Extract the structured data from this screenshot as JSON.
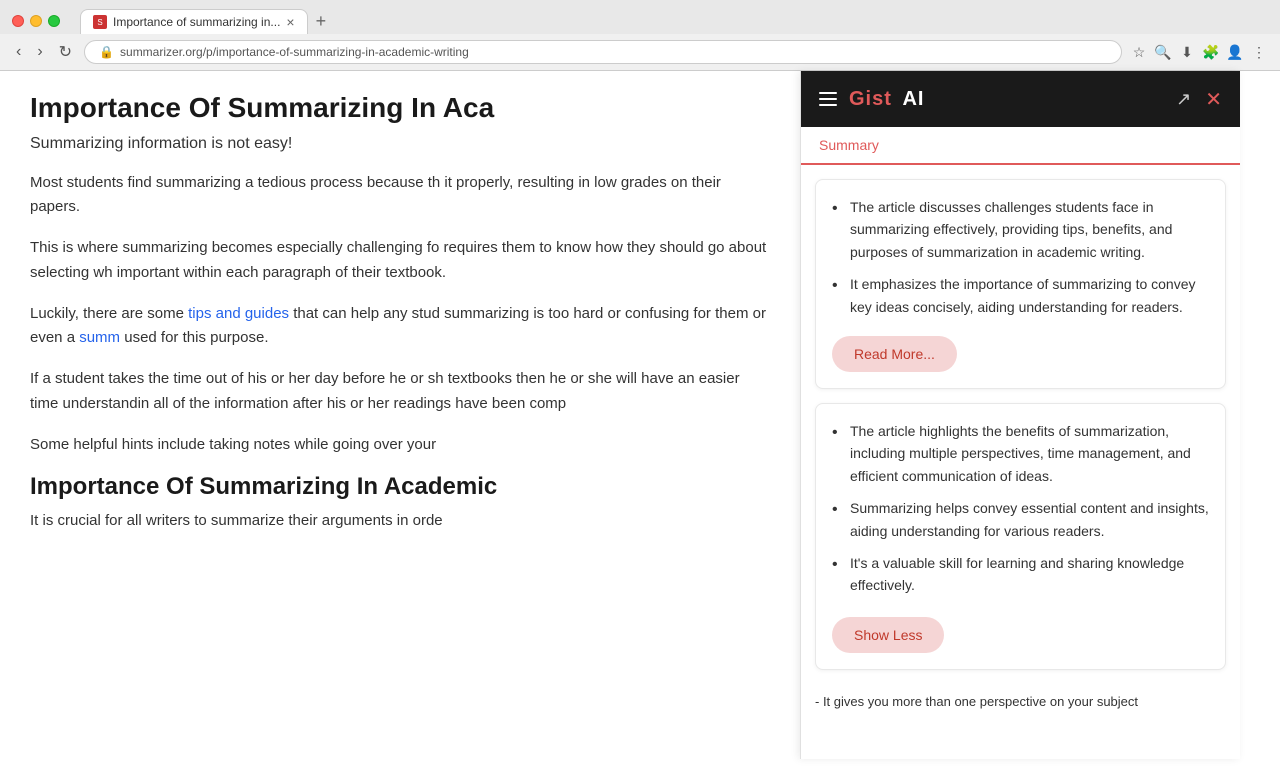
{
  "browser": {
    "tab_title": "Importance of summarizing in...",
    "tab_favicon": "S",
    "url": "summarizer.org/p/importance-of-summarizing-in-academic-writing",
    "new_tab_icon": "+",
    "nav_back": "‹",
    "nav_forward": "›",
    "nav_reload": "↺",
    "actions": [
      "🔍",
      "★",
      "⬇",
      "⋮",
      "□",
      "👤"
    ]
  },
  "article": {
    "title": "Importance Of Summarizing In Aca",
    "subtitle": "Summarizing information is not easy!",
    "paragraph1": "Most students find summarizing a tedious process because th it properly, resulting in low grades on their papers.",
    "paragraph2": "This is where summarizing becomes especially challenging fo requires them to know how they should go about selecting wh important within each paragraph of their textbook.",
    "paragraph3_prefix": "Luckily, there are some ",
    "paragraph3_link1": "tips and guides",
    "paragraph3_middle": " that can help any stud summarizing is too hard or confusing for them or even a ",
    "paragraph3_link2": "summ",
    "paragraph3_suffix": " used for this purpose.",
    "paragraph4": "If a student takes the time out of his or her day before he or sh textbooks then he or she will have an easier time understandin all of the information after his or her readings have been comp",
    "paragraph5": "Some helpful hints include taking notes while going over your",
    "heading2": "Importance Of Summarizing In Academic",
    "paragraph6": "It is crucial for all writers to summarize their arguments in orde"
  },
  "panel": {
    "logo_gist": "Gist",
    "logo_ai": "AI",
    "tab_label": "Summary",
    "card1": {
      "bullets": [
        "The article discusses challenges students face in summarizing effectively, providing tips, benefits, and purposes of summarization in academic writing.",
        "It emphasizes the importance of summarizing to convey key ideas concisely, aiding understanding for readers."
      ],
      "read_more_label": "Read More..."
    },
    "card2": {
      "bullets": [
        "The article highlights the benefits of summarization, including multiple perspectives, time management, and efficient communication of ideas.",
        "Summarizing helps convey essential content and insights, aiding understanding for various readers.",
        "It's a valuable skill for learning and sharing knowledge effectively."
      ],
      "show_less_label": "Show Less"
    },
    "footer_text": "- It gives you more than one perspective on your subject"
  },
  "icons": {
    "hamburger": "☰",
    "share": "↗",
    "close": "×",
    "search": "🔍",
    "star": "☆",
    "download": "⬇",
    "more": "⋮",
    "extensions": "🧩",
    "profile": "👤",
    "lock": "🔒",
    "refresh": "↻"
  }
}
